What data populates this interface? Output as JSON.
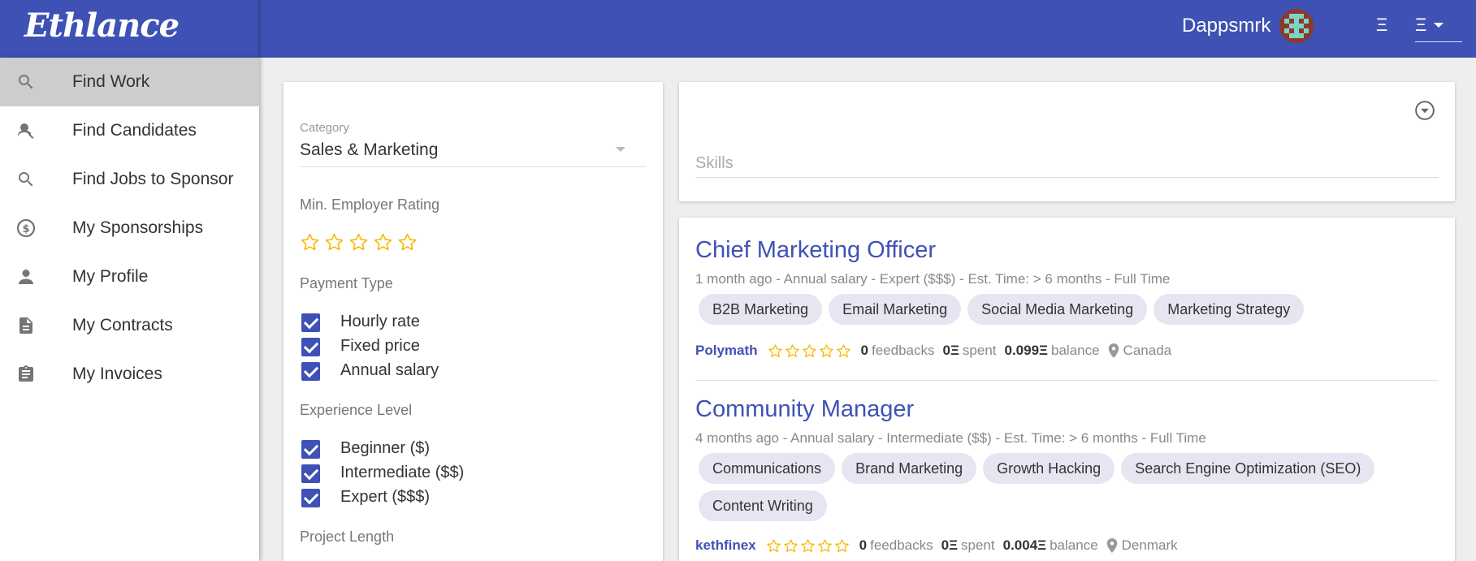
{
  "app": {
    "logo": "Ethlance",
    "username": "Dappsmrk",
    "eth_symbol": "Ξ",
    "accent_color": "#3f51b5",
    "star_color": "#f5b800"
  },
  "sidebar": {
    "items": [
      {
        "label": "Find Work",
        "icon": "search-icon",
        "active": true
      },
      {
        "label": "Find Candidates",
        "icon": "person-search-icon",
        "active": false
      },
      {
        "label": "Find Jobs to Sponsor",
        "icon": "search-icon",
        "active": false
      },
      {
        "label": "My Sponsorships",
        "icon": "dollar-circle-icon",
        "active": false
      },
      {
        "label": "My Profile",
        "icon": "person-icon",
        "active": false
      },
      {
        "label": "My Contracts",
        "icon": "document-icon",
        "active": false
      },
      {
        "label": "My Invoices",
        "icon": "clipboard-icon",
        "active": false
      }
    ]
  },
  "filters": {
    "category": {
      "label": "Category",
      "value": "Sales & Marketing"
    },
    "min_rating_label": "Min. Employer Rating",
    "min_rating_value": 0,
    "payment_type": {
      "label": "Payment Type",
      "options": [
        {
          "label": "Hourly rate",
          "checked": true
        },
        {
          "label": "Fixed price",
          "checked": true
        },
        {
          "label": "Annual salary",
          "checked": true
        }
      ]
    },
    "experience_level": {
      "label": "Experience Level",
      "options": [
        {
          "label": "Beginner ($)",
          "checked": true
        },
        {
          "label": "Intermediate ($$)",
          "checked": true
        },
        {
          "label": "Expert ($$$)",
          "checked": true
        }
      ]
    },
    "project_length_label": "Project Length"
  },
  "skills": {
    "placeholder": "Skills"
  },
  "jobs": [
    {
      "title": "Chief Marketing Officer",
      "meta": "1 month ago - Annual salary - Expert ($$$) - Est. Time: > 6 months - Full Time",
      "skills": [
        "B2B Marketing",
        "Email Marketing",
        "Social Media Marketing",
        "Marketing Strategy"
      ],
      "employer": "Polymath",
      "rating": 0,
      "feedbacks_count": "0",
      "feedbacks_label": "feedbacks",
      "spent": "0Ξ",
      "spent_label": "spent",
      "balance": "0.099Ξ",
      "balance_label": "balance",
      "location": "Canada"
    },
    {
      "title": "Community Manager",
      "meta": "4 months ago - Annual salary - Intermediate ($$) - Est. Time: > 6 months - Full Time",
      "skills": [
        "Communications",
        "Brand Marketing",
        "Growth Hacking",
        "Search Engine Optimization (SEO)",
        "Content Writing"
      ],
      "employer": "kethfinex",
      "rating": 0,
      "feedbacks_count": "0",
      "feedbacks_label": "feedbacks",
      "spent": "0Ξ",
      "spent_label": "spent",
      "balance": "0.004Ξ",
      "balance_label": "balance",
      "location": "Denmark"
    }
  ]
}
